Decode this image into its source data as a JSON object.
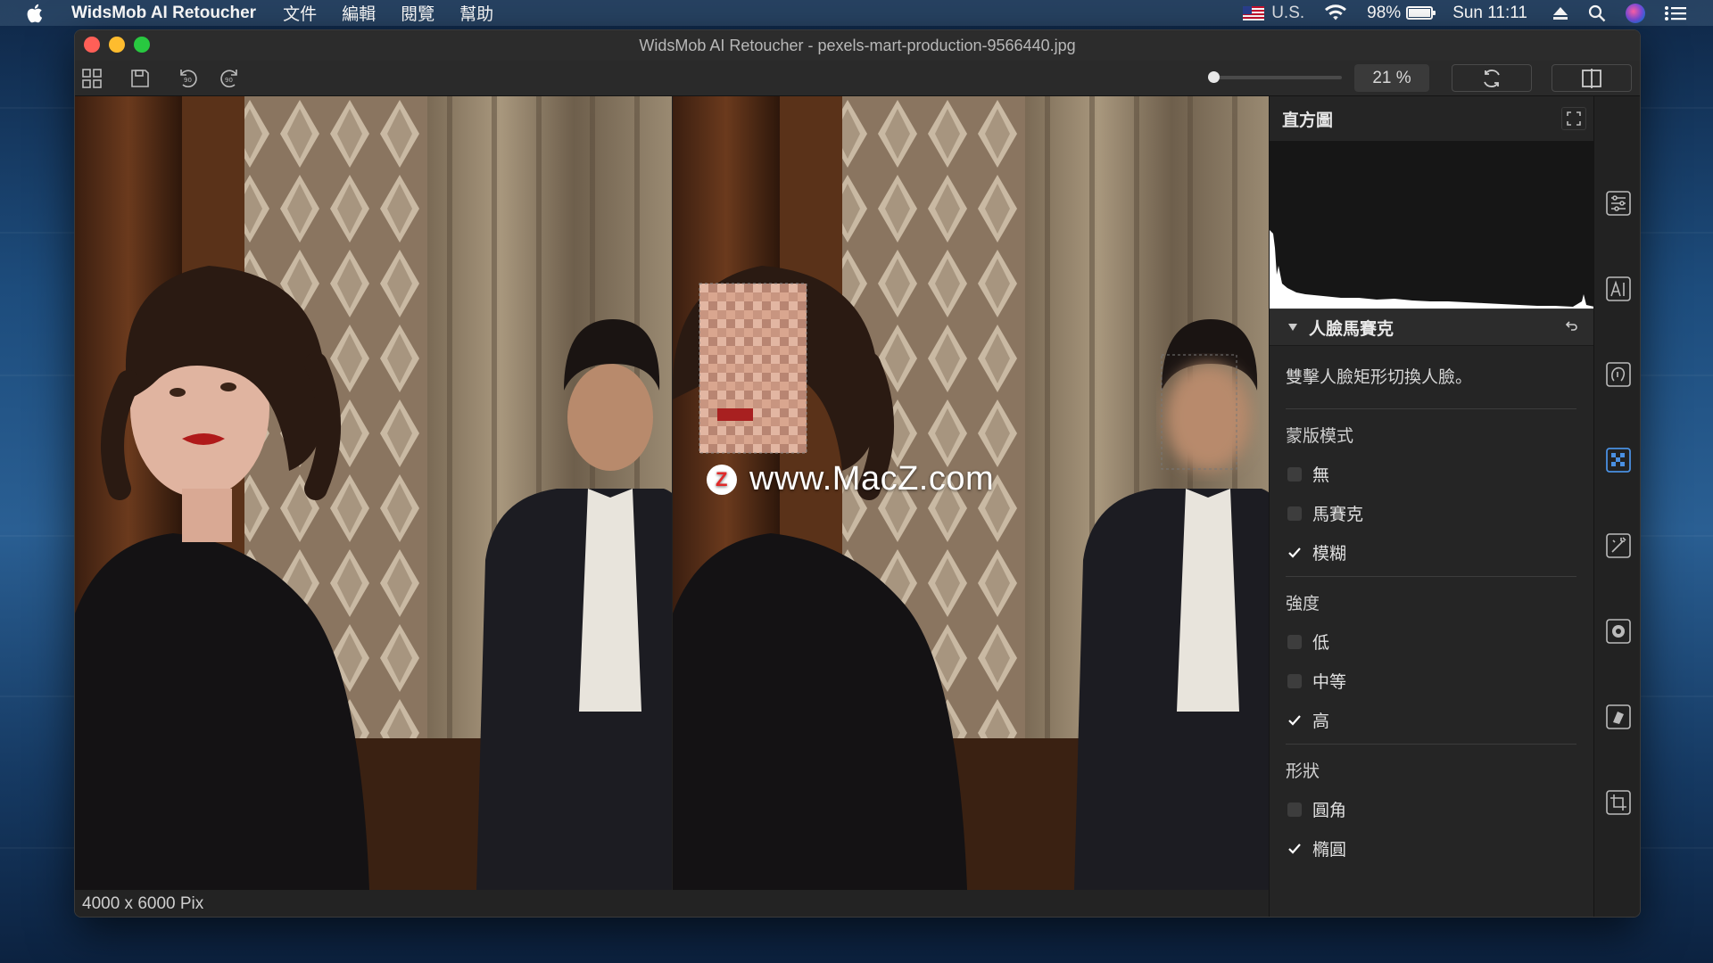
{
  "menubar": {
    "app_name": "WidsMob AI Retoucher",
    "items": [
      "文件",
      "編輯",
      "閱覽",
      "幫助"
    ],
    "input_source": "U.S.",
    "battery": "98%",
    "clock": "Sun 11:11"
  },
  "window": {
    "title": "WidsMob AI Retoucher - pexels-mart-production-9566440.jpg"
  },
  "toolbar": {
    "zoom": "21 %",
    "zoom_level": 0.0
  },
  "status": {
    "dimensions": "4000 x 6000 Pix"
  },
  "watermark": {
    "text": "www.MacZ.com",
    "logo_letter": "Z"
  },
  "panel": {
    "histogram_title": "直方圖",
    "section_title": "人臉馬賽克",
    "description": "雙擊人臉矩形切換人臉。",
    "mask_mode": {
      "title": "蒙版模式",
      "options": [
        {
          "label": "無",
          "checked": false
        },
        {
          "label": "馬賽克",
          "checked": false
        },
        {
          "label": "模糊",
          "checked": true
        }
      ]
    },
    "strength": {
      "title": "強度",
      "options": [
        {
          "label": "低",
          "checked": false
        },
        {
          "label": "中等",
          "checked": false
        },
        {
          "label": "高",
          "checked": true
        }
      ]
    },
    "shape": {
      "title": "形狀",
      "options": [
        {
          "label": "圓角",
          "checked": false
        },
        {
          "label": "橢圓",
          "checked": true
        }
      ]
    }
  },
  "rail": [
    "adjust-sliders-icon",
    "ai-icon",
    "face-icon",
    "mosaic-icon",
    "magic-wand-icon",
    "gear-icon",
    "eraser-icon",
    "crop-icon"
  ],
  "colors": {
    "accent": "#4a90e2",
    "close": "#ff5f57",
    "minimize": "#febc2e",
    "zoom": "#28c840"
  }
}
